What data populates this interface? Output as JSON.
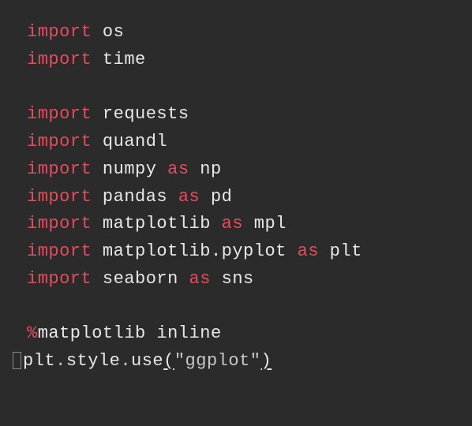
{
  "colors": {
    "background": "#2b2b2b",
    "keyword": "#e64c5e",
    "identifier": "#e8e8e8",
    "punctuation": "#c8c8c8",
    "string": "#c8c8c8"
  },
  "kw": {
    "import": "import",
    "as": "as"
  },
  "mods": {
    "os": "os",
    "time": "time",
    "requests": "requests",
    "quandl": "quandl",
    "numpy": "numpy",
    "np": "np",
    "pandas": "pandas",
    "pd": "pd",
    "matplotlib": "matplotlib",
    "mpl": "mpl",
    "matplotlib_pyplot": "matplotlib.pyplot",
    "plt": "plt",
    "seaborn": "seaborn",
    "sns": "sns"
  },
  "magic": {
    "percent": "%",
    "text": "matplotlib inline"
  },
  "stmt": {
    "plt": "plt",
    "style": "style",
    "use": "use",
    "open_paren": "(",
    "arg": "\"ggplot\"",
    "close_paren": ")"
  }
}
